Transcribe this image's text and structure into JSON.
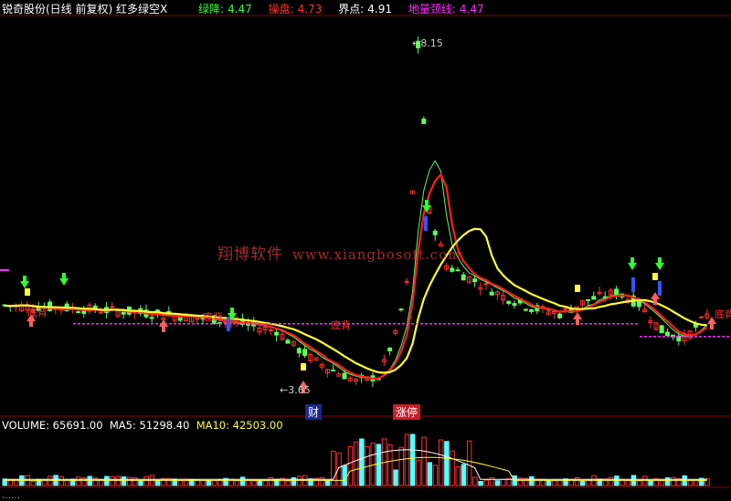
{
  "header": {
    "stock_name": "锐奇股份(日线 前复权) 红多绿空X",
    "items": [
      {
        "label": "绿降:",
        "value": "4.47",
        "color": "#2eff2e"
      },
      {
        "label": "操盘:",
        "value": "4.73",
        "color": "#ff3030"
      },
      {
        "label": "界点:",
        "value": "4.91",
        "color": "#ffffff"
      },
      {
        "label": "地量颈线:",
        "value": "4.47",
        "color": "#ff2cff"
      }
    ]
  },
  "volume_header": {
    "volume": "VOLUME: 65691.00",
    "ma5": "MA5: 51298.40",
    "ma10": "MA10: 42503.00"
  },
  "watermark": {
    "cn": "翔博软件",
    "url": "www.xiangbosoft.com"
  },
  "tags": {
    "cai": "财",
    "zhangting": "涨停"
  },
  "signals": {
    "s1": "底背",
    "s2": "底背",
    "s3": "底背",
    "s4": "底背"
  },
  "price_labels": {
    "high": "8.15",
    "low": "3.65"
  },
  "bottom_header": "……",
  "chart_data": {
    "type": "candlestick",
    "price_range": [
      3.4,
      8.4
    ],
    "high_point": 8.15,
    "low_point": 3.65,
    "neckline": 4.47,
    "colors": {
      "up": "#ff3030",
      "down": "#5cff5c",
      "ma_red": "#ff2020",
      "ma_yellow": "#ffff33",
      "neck": "#ff2cff",
      "vol_cyan": "#55ffff"
    }
  }
}
